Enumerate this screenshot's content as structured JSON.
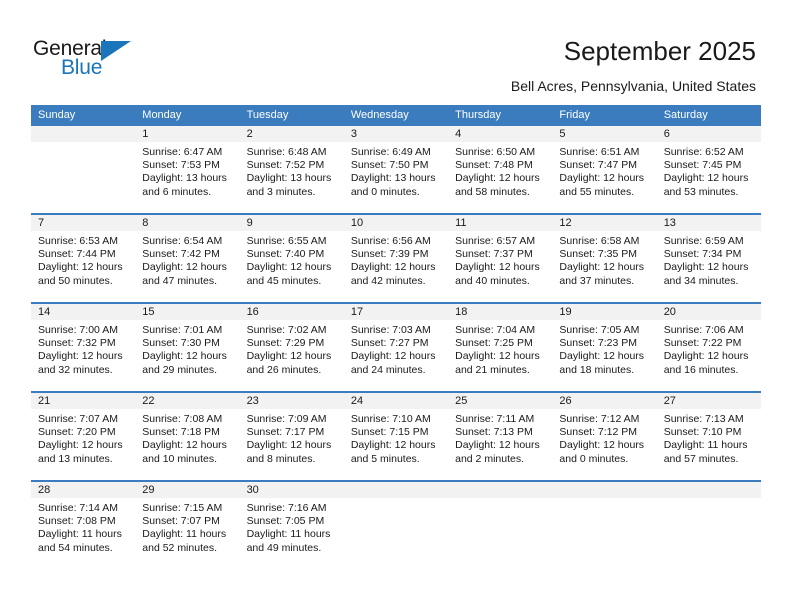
{
  "brand": {
    "name_part1": "General",
    "name_part2": "Blue",
    "accent_color": "#1b75bb"
  },
  "header": {
    "title": "September 2025",
    "subtitle": "Bell Acres, Pennsylvania, United States"
  },
  "calendar": {
    "header_color": "#3b7cbe",
    "weekdays": [
      "Sunday",
      "Monday",
      "Tuesday",
      "Wednesday",
      "Thursday",
      "Friday",
      "Saturday"
    ],
    "weeks": [
      [
        {
          "day": "",
          "sunrise": "",
          "sunset": "",
          "daylight_line1": "",
          "daylight_line2": "",
          "empty": true
        },
        {
          "day": "1",
          "sunrise": "Sunrise: 6:47 AM",
          "sunset": "Sunset: 7:53 PM",
          "daylight_line1": "Daylight: 13 hours",
          "daylight_line2": "and 6 minutes."
        },
        {
          "day": "2",
          "sunrise": "Sunrise: 6:48 AM",
          "sunset": "Sunset: 7:52 PM",
          "daylight_line1": "Daylight: 13 hours",
          "daylight_line2": "and 3 minutes."
        },
        {
          "day": "3",
          "sunrise": "Sunrise: 6:49 AM",
          "sunset": "Sunset: 7:50 PM",
          "daylight_line1": "Daylight: 13 hours",
          "daylight_line2": "and 0 minutes."
        },
        {
          "day": "4",
          "sunrise": "Sunrise: 6:50 AM",
          "sunset": "Sunset: 7:48 PM",
          "daylight_line1": "Daylight: 12 hours",
          "daylight_line2": "and 58 minutes."
        },
        {
          "day": "5",
          "sunrise": "Sunrise: 6:51 AM",
          "sunset": "Sunset: 7:47 PM",
          "daylight_line1": "Daylight: 12 hours",
          "daylight_line2": "and 55 minutes."
        },
        {
          "day": "6",
          "sunrise": "Sunrise: 6:52 AM",
          "sunset": "Sunset: 7:45 PM",
          "daylight_line1": "Daylight: 12 hours",
          "daylight_line2": "and 53 minutes."
        }
      ],
      [
        {
          "day": "7",
          "sunrise": "Sunrise: 6:53 AM",
          "sunset": "Sunset: 7:44 PM",
          "daylight_line1": "Daylight: 12 hours",
          "daylight_line2": "and 50 minutes."
        },
        {
          "day": "8",
          "sunrise": "Sunrise: 6:54 AM",
          "sunset": "Sunset: 7:42 PM",
          "daylight_line1": "Daylight: 12 hours",
          "daylight_line2": "and 47 minutes."
        },
        {
          "day": "9",
          "sunrise": "Sunrise: 6:55 AM",
          "sunset": "Sunset: 7:40 PM",
          "daylight_line1": "Daylight: 12 hours",
          "daylight_line2": "and 45 minutes."
        },
        {
          "day": "10",
          "sunrise": "Sunrise: 6:56 AM",
          "sunset": "Sunset: 7:39 PM",
          "daylight_line1": "Daylight: 12 hours",
          "daylight_line2": "and 42 minutes."
        },
        {
          "day": "11",
          "sunrise": "Sunrise: 6:57 AM",
          "sunset": "Sunset: 7:37 PM",
          "daylight_line1": "Daylight: 12 hours",
          "daylight_line2": "and 40 minutes."
        },
        {
          "day": "12",
          "sunrise": "Sunrise: 6:58 AM",
          "sunset": "Sunset: 7:35 PM",
          "daylight_line1": "Daylight: 12 hours",
          "daylight_line2": "and 37 minutes."
        },
        {
          "day": "13",
          "sunrise": "Sunrise: 6:59 AM",
          "sunset": "Sunset: 7:34 PM",
          "daylight_line1": "Daylight: 12 hours",
          "daylight_line2": "and 34 minutes."
        }
      ],
      [
        {
          "day": "14",
          "sunrise": "Sunrise: 7:00 AM",
          "sunset": "Sunset: 7:32 PM",
          "daylight_line1": "Daylight: 12 hours",
          "daylight_line2": "and 32 minutes."
        },
        {
          "day": "15",
          "sunrise": "Sunrise: 7:01 AM",
          "sunset": "Sunset: 7:30 PM",
          "daylight_line1": "Daylight: 12 hours",
          "daylight_line2": "and 29 minutes."
        },
        {
          "day": "16",
          "sunrise": "Sunrise: 7:02 AM",
          "sunset": "Sunset: 7:29 PM",
          "daylight_line1": "Daylight: 12 hours",
          "daylight_line2": "and 26 minutes."
        },
        {
          "day": "17",
          "sunrise": "Sunrise: 7:03 AM",
          "sunset": "Sunset: 7:27 PM",
          "daylight_line1": "Daylight: 12 hours",
          "daylight_line2": "and 24 minutes."
        },
        {
          "day": "18",
          "sunrise": "Sunrise: 7:04 AM",
          "sunset": "Sunset: 7:25 PM",
          "daylight_line1": "Daylight: 12 hours",
          "daylight_line2": "and 21 minutes."
        },
        {
          "day": "19",
          "sunrise": "Sunrise: 7:05 AM",
          "sunset": "Sunset: 7:23 PM",
          "daylight_line1": "Daylight: 12 hours",
          "daylight_line2": "and 18 minutes."
        },
        {
          "day": "20",
          "sunrise": "Sunrise: 7:06 AM",
          "sunset": "Sunset: 7:22 PM",
          "daylight_line1": "Daylight: 12 hours",
          "daylight_line2": "and 16 minutes."
        }
      ],
      [
        {
          "day": "21",
          "sunrise": "Sunrise: 7:07 AM",
          "sunset": "Sunset: 7:20 PM",
          "daylight_line1": "Daylight: 12 hours",
          "daylight_line2": "and 13 minutes."
        },
        {
          "day": "22",
          "sunrise": "Sunrise: 7:08 AM",
          "sunset": "Sunset: 7:18 PM",
          "daylight_line1": "Daylight: 12 hours",
          "daylight_line2": "and 10 minutes."
        },
        {
          "day": "23",
          "sunrise": "Sunrise: 7:09 AM",
          "sunset": "Sunset: 7:17 PM",
          "daylight_line1": "Daylight: 12 hours",
          "daylight_line2": "and 8 minutes."
        },
        {
          "day": "24",
          "sunrise": "Sunrise: 7:10 AM",
          "sunset": "Sunset: 7:15 PM",
          "daylight_line1": "Daylight: 12 hours",
          "daylight_line2": "and 5 minutes."
        },
        {
          "day": "25",
          "sunrise": "Sunrise: 7:11 AM",
          "sunset": "Sunset: 7:13 PM",
          "daylight_line1": "Daylight: 12 hours",
          "daylight_line2": "and 2 minutes."
        },
        {
          "day": "26",
          "sunrise": "Sunrise: 7:12 AM",
          "sunset": "Sunset: 7:12 PM",
          "daylight_line1": "Daylight: 12 hours",
          "daylight_line2": "and 0 minutes."
        },
        {
          "day": "27",
          "sunrise": "Sunrise: 7:13 AM",
          "sunset": "Sunset: 7:10 PM",
          "daylight_line1": "Daylight: 11 hours",
          "daylight_line2": "and 57 minutes."
        }
      ],
      [
        {
          "day": "28",
          "sunrise": "Sunrise: 7:14 AM",
          "sunset": "Sunset: 7:08 PM",
          "daylight_line1": "Daylight: 11 hours",
          "daylight_line2": "and 54 minutes."
        },
        {
          "day": "29",
          "sunrise": "Sunrise: 7:15 AM",
          "sunset": "Sunset: 7:07 PM",
          "daylight_line1": "Daylight: 11 hours",
          "daylight_line2": "and 52 minutes."
        },
        {
          "day": "30",
          "sunrise": "Sunrise: 7:16 AM",
          "sunset": "Sunset: 7:05 PM",
          "daylight_line1": "Daylight: 11 hours",
          "daylight_line2": "and 49 minutes."
        },
        {
          "day": "",
          "sunrise": "",
          "sunset": "",
          "daylight_line1": "",
          "daylight_line2": "",
          "empty": true
        },
        {
          "day": "",
          "sunrise": "",
          "sunset": "",
          "daylight_line1": "",
          "daylight_line2": "",
          "empty": true
        },
        {
          "day": "",
          "sunrise": "",
          "sunset": "",
          "daylight_line1": "",
          "daylight_line2": "",
          "empty": true
        },
        {
          "day": "",
          "sunrise": "",
          "sunset": "",
          "daylight_line1": "",
          "daylight_line2": "",
          "empty": true
        }
      ]
    ]
  }
}
